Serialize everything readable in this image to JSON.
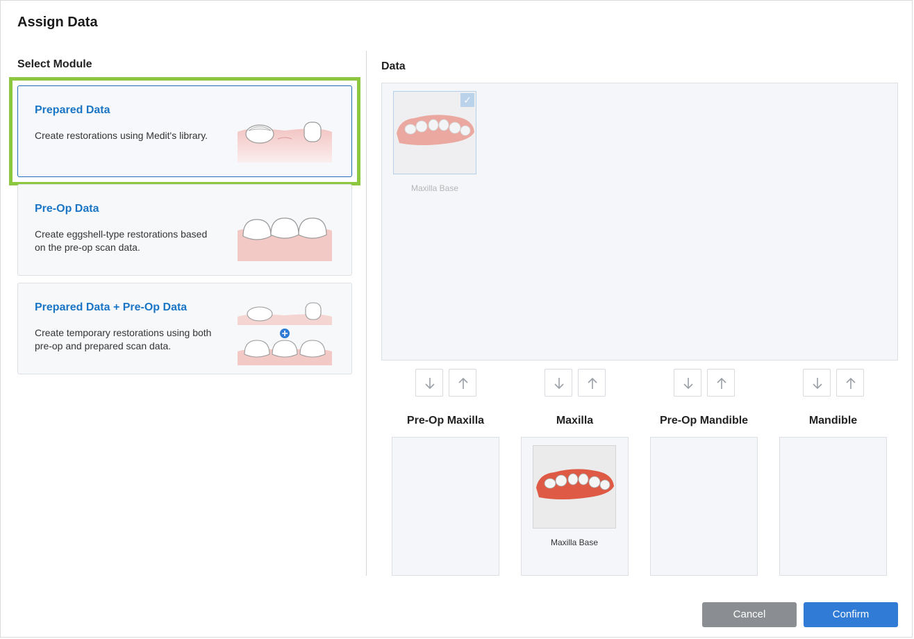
{
  "dialog": {
    "title": "Assign Data",
    "cancel_label": "Cancel",
    "confirm_label": "Confirm"
  },
  "module_section": {
    "title": "Select Module",
    "modules": [
      {
        "title": "Prepared Data",
        "description": "Create restorations using Medit's library.",
        "selected": true
      },
      {
        "title": "Pre-Op Data",
        "description": "Create eggshell-type restorations based on the pre-op scan data.",
        "selected": false
      },
      {
        "title": "Prepared Data + Pre-Op Data",
        "description": "Create temporary restorations using both pre-op and prepared scan data.",
        "selected": false
      }
    ]
  },
  "data_section": {
    "title": "Data",
    "items": [
      {
        "label": "Maxilla Base",
        "checked": true
      }
    ]
  },
  "slots": [
    {
      "title": "Pre-Op Maxilla",
      "items": []
    },
    {
      "title": "Maxilla",
      "items": [
        {
          "label": "Maxilla Base"
        }
      ]
    },
    {
      "title": "Pre-Op Mandible",
      "items": []
    },
    {
      "title": "Mandible",
      "items": []
    }
  ],
  "colors": {
    "accent": "#1a76c5",
    "highlight": "#8dc63f",
    "confirm": "#2f7bd6",
    "cancel": "#8a8d91"
  }
}
